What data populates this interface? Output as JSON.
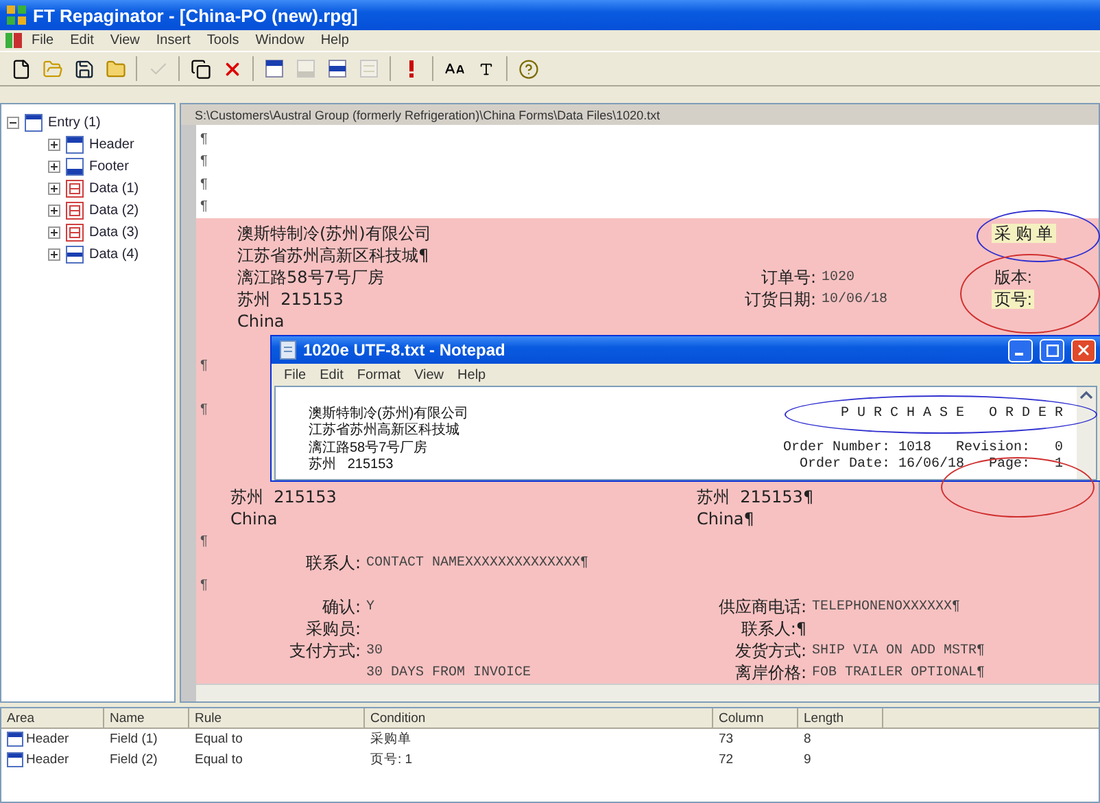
{
  "window": {
    "title": "FT Repaginator - [China-PO (new).rpg]"
  },
  "menu": [
    "File",
    "Edit",
    "View",
    "Insert",
    "Tools",
    "Window",
    "Help"
  ],
  "toolbar": [
    {
      "kind": "new",
      "disabled": false
    },
    {
      "kind": "open",
      "disabled": false
    },
    {
      "kind": "save",
      "disabled": false
    },
    {
      "kind": "folder",
      "disabled": false
    },
    {
      "kind": "sep"
    },
    {
      "kind": "check",
      "disabled": true
    },
    {
      "kind": "sep"
    },
    {
      "kind": "window",
      "disabled": false
    },
    {
      "kind": "delete",
      "disabled": false
    },
    {
      "kind": "sep"
    },
    {
      "kind": "header",
      "disabled": false
    },
    {
      "kind": "footer",
      "disabled": true
    },
    {
      "kind": "data",
      "disabled": false
    },
    {
      "kind": "lines",
      "disabled": true
    },
    {
      "kind": "sep"
    },
    {
      "kind": "alert",
      "disabled": false
    },
    {
      "kind": "sep"
    },
    {
      "kind": "grow",
      "disabled": false
    },
    {
      "kind": "shrink",
      "disabled": false
    },
    {
      "kind": "sep"
    },
    {
      "kind": "help",
      "disabled": false
    }
  ],
  "tree": [
    {
      "label": "Entry (1)",
      "kind": "entry",
      "expanded": true,
      "children": [
        {
          "label": "Header",
          "kind": "header",
          "expanded": false
        },
        {
          "label": "Footer",
          "kind": "footer",
          "expanded": false
        },
        {
          "label": "Data (1)",
          "kind": "data",
          "expanded": false
        },
        {
          "label": "Data (2)",
          "kind": "data",
          "expanded": false
        },
        {
          "label": "Data (3)",
          "kind": "data",
          "expanded": false
        },
        {
          "label": "Data (4)",
          "kind": "data_bar",
          "expanded": false
        }
      ]
    }
  ],
  "document": {
    "path": "S:\\Customers\\Austral Group (formerly Refrigeration)\\China Forms\\Data Files\\1020.txt",
    "plain_lines": [
      {
        "kind": "mark",
        "text": "¶"
      },
      {
        "kind": "mark",
        "text": "¶"
      },
      {
        "kind": "mark",
        "text": "¶"
      },
      {
        "kind": "mark",
        "text": "¶"
      }
    ],
    "entry_lines": [
      {
        "kind": "head",
        "left": "澳斯特制冷(苏州)有限公司",
        "right": "采 购 单",
        "highlighted": true
      },
      {
        "kind": "head",
        "left": "江苏省苏州高新区科技城¶"
      },
      {
        "kind": "head",
        "left": "漓江路58号7号厂房",
        "mid_label": "订单号:",
        "mid_value": "1020",
        "right": "版本:",
        "highlighted": false
      },
      {
        "kind": "head",
        "left": "苏州  215153",
        "mid_label": "订货日期:",
        "mid_value": "10/06/18",
        "right": "页号:",
        "highlighted": true
      },
      {
        "kind": "head",
        "left": "China"
      },
      {
        "kind": "gap"
      },
      {
        "kind": "mark",
        "text": "¶"
      },
      {
        "kind": "gap"
      },
      {
        "kind": "mark",
        "text": "¶"
      },
      {
        "kind": "gap"
      },
      {
        "kind": "gap"
      },
      {
        "kind": "gap"
      },
      {
        "kind": "addr",
        "left": "苏州  215153",
        "right": "苏州  215153¶"
      },
      {
        "kind": "addr",
        "left": "China",
        "right": "China¶"
      },
      {
        "kind": "mark",
        "text": "¶"
      },
      {
        "kind": "pair",
        "left_label": "联系人:",
        "left_value": "CONTACT NAMEXXXXXXXXXXXXXX¶"
      },
      {
        "kind": "mark",
        "text": "¶"
      },
      {
        "kind": "pair",
        "left_label": "确认:",
        "left_value": "Y",
        "right_label": "供应商电话:",
        "right_value": "TELEPHONENOXXXXXX¶"
      },
      {
        "kind": "pair",
        "left_label": "采购员:",
        "right_label": "联系人:¶"
      },
      {
        "kind": "pair",
        "left_label": "支付方式:",
        "left_value": "30",
        "right_label": "发货方式:",
        "right_value": "SHIP VIA ON ADD MSTR¶"
      },
      {
        "kind": "pair",
        "left_value": "30 DAYS FROM INVOICE",
        "right_label": "离岸价格:",
        "right_value": "FOB TRAILER OPTIONAL¶"
      }
    ]
  },
  "notepad": {
    "title": "1020e UTF-8.txt - Notepad",
    "menu": [
      "File",
      "Edit",
      "Format",
      "View",
      "Help"
    ],
    "lines": [
      {
        "left": "澳斯特制冷(苏州)有限公司",
        "right": "P U R C H A S E   O R D E R"
      },
      {
        "left": "江苏省苏州高新区科技城"
      },
      {
        "left": "漓江路58号7号厂房",
        "right": "Order Number: 1018   Revision:   0"
      },
      {
        "left": "苏州   215153",
        "right": "Order Date: 16/06/18   Page:   1"
      }
    ]
  },
  "grid": {
    "columns": [
      "Area",
      "Name",
      "Rule",
      "Condition",
      "Column",
      "Length"
    ],
    "rows": [
      {
        "area": "Header",
        "name": "Field (1)",
        "rule": "Equal to",
        "condition": "采购单",
        "column": "73",
        "length": "8"
      },
      {
        "area": "Header",
        "name": "Field (2)",
        "rule": "Equal to",
        "condition": "页号: 1",
        "column": "72",
        "length": "9"
      }
    ]
  }
}
